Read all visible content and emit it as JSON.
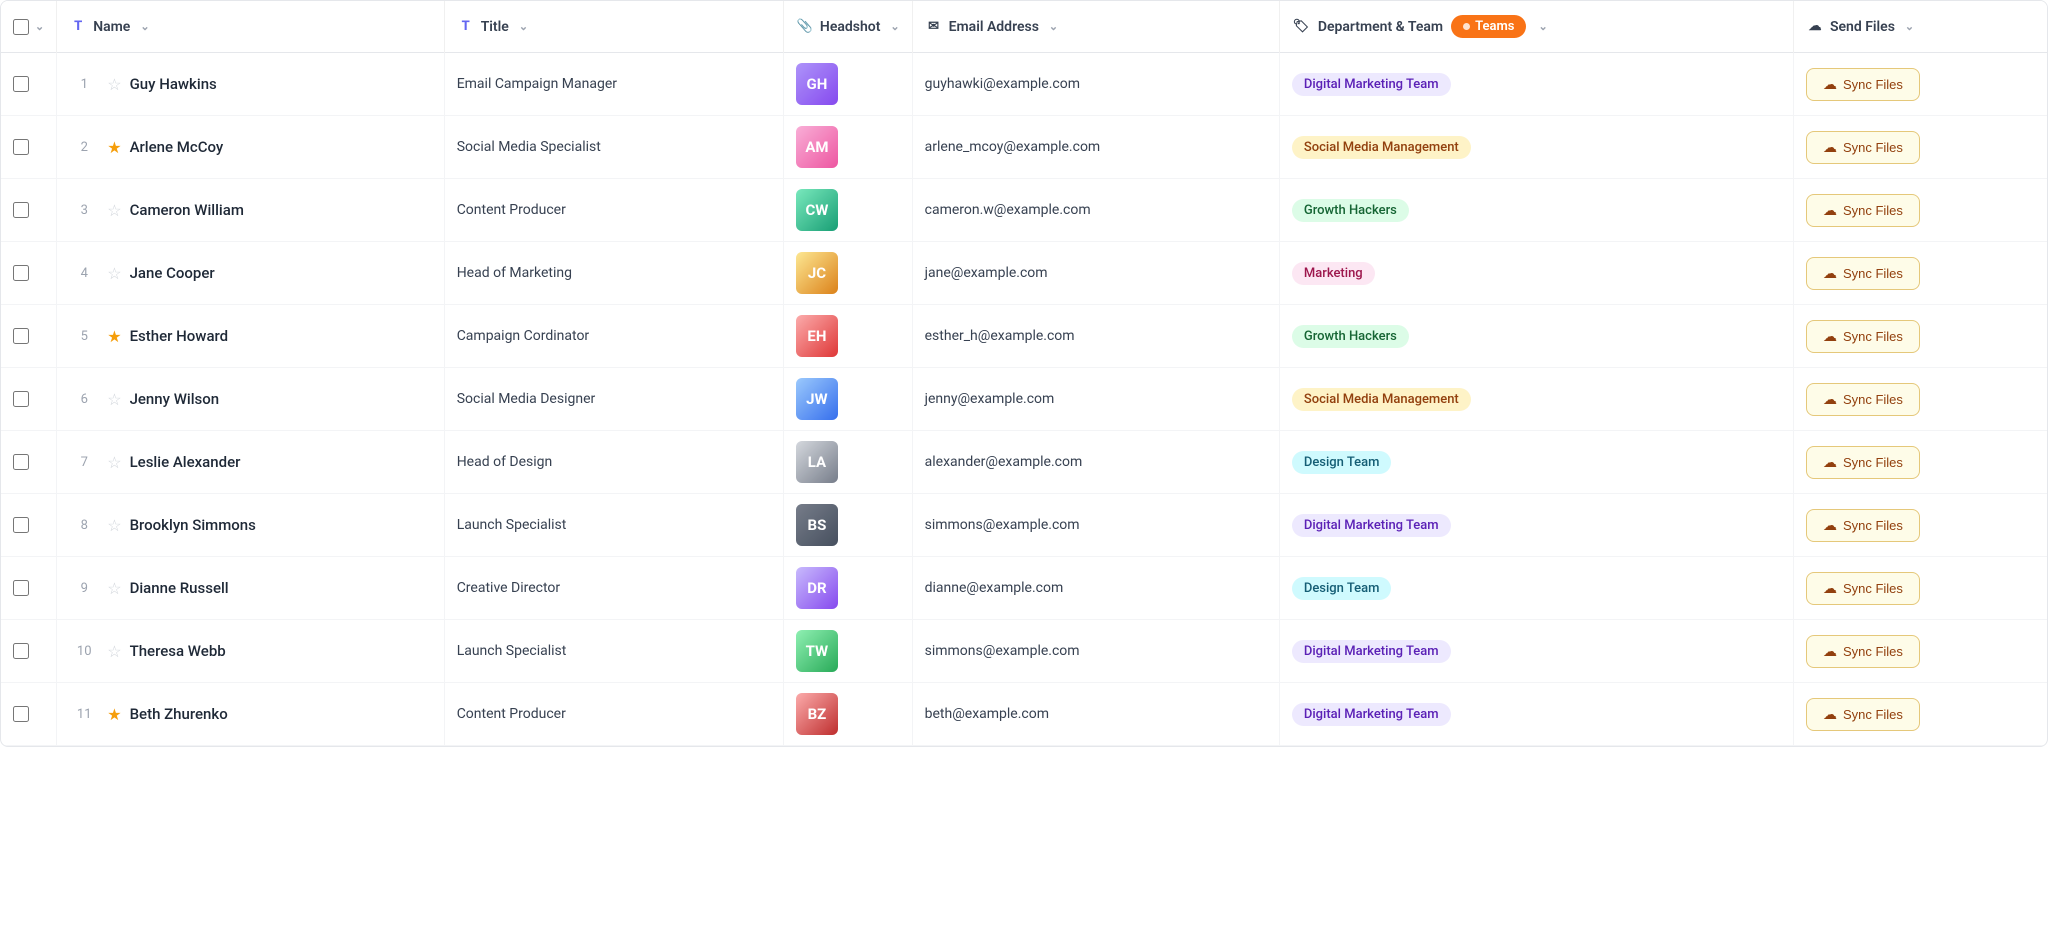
{
  "header": {
    "checkbox_label": "select-all",
    "columns": [
      {
        "id": "name",
        "icon": "T",
        "label": "Name",
        "sortable": true
      },
      {
        "id": "title",
        "icon": "T",
        "label": "Title",
        "sortable": true
      },
      {
        "id": "headshot",
        "icon": "📎",
        "label": "Headshot",
        "sortable": true
      },
      {
        "id": "email",
        "icon": "✉",
        "label": "Email Address",
        "sortable": true
      },
      {
        "id": "dept",
        "icon": "🏷",
        "label": "Department & Team",
        "sortable": true,
        "filter_badge": "Teams"
      },
      {
        "id": "send_files",
        "icon": "☁",
        "label": "Send Files",
        "sortable": true
      }
    ]
  },
  "rows": [
    {
      "num": 1,
      "starred": false,
      "name": "Guy Hawkins",
      "title": "Email Campaign Manager",
      "email": "guyhawki@example.com",
      "dept": "Digital Marketing Team",
      "dept_class": "badge-purple",
      "avatar_class": "av1",
      "avatar_initials": "GH",
      "sync_label": "Sync Files"
    },
    {
      "num": 2,
      "starred": true,
      "name": "Arlene McCoy",
      "title": "Social Media Specialist",
      "email": "arlene_mcoy@example.com",
      "dept": "Social Media Management",
      "dept_class": "badge-yellow",
      "avatar_class": "av2",
      "avatar_initials": "AM",
      "sync_label": "Sync Files"
    },
    {
      "num": 3,
      "starred": false,
      "name": "Cameron William",
      "title": "Content Producer",
      "email": "cameron.w@example.com",
      "dept": "Growth Hackers",
      "dept_class": "badge-green",
      "avatar_class": "av3",
      "avatar_initials": "CW",
      "sync_label": "Sync Files"
    },
    {
      "num": 4,
      "starred": false,
      "name": "Jane Cooper",
      "title": "Head of Marketing",
      "email": "jane@example.com",
      "dept": "Marketing",
      "dept_class": "badge-pink",
      "avatar_class": "av4",
      "avatar_initials": "JC",
      "sync_label": "Sync Files"
    },
    {
      "num": 5,
      "starred": true,
      "name": "Esther Howard",
      "title": "Campaign Cordinator",
      "email": "esther_h@example.com",
      "dept": "Growth Hackers",
      "dept_class": "badge-green",
      "avatar_class": "av5",
      "avatar_initials": "EH",
      "sync_label": "Sync Files"
    },
    {
      "num": 6,
      "starred": false,
      "name": "Jenny Wilson",
      "title": "Social Media Designer",
      "email": "jenny@example.com",
      "dept": "Social Media Management",
      "dept_class": "badge-yellow",
      "avatar_class": "av6",
      "avatar_initials": "JW",
      "sync_label": "Sync Files"
    },
    {
      "num": 7,
      "starred": false,
      "name": "Leslie Alexander",
      "title": "Head of Design",
      "email": "alexander@example.com",
      "dept": "Design Team",
      "dept_class": "badge-cyan",
      "avatar_class": "av7",
      "avatar_initials": "LA",
      "sync_label": "Sync Files"
    },
    {
      "num": 8,
      "starred": false,
      "name": "Brooklyn Simmons",
      "title": "Launch Specialist",
      "email": "simmons@example.com",
      "dept": "Digital Marketing Team",
      "dept_class": "badge-purple",
      "avatar_class": "av8",
      "avatar_initials": "BS",
      "sync_label": "Sync Files"
    },
    {
      "num": 9,
      "starred": false,
      "name": "Dianne Russell",
      "title": "Creative Director",
      "email": "dianne@example.com",
      "dept": "Design Team",
      "dept_class": "badge-cyan",
      "avatar_class": "av9",
      "avatar_initials": "DR",
      "sync_label": "Sync Files"
    },
    {
      "num": 10,
      "starred": false,
      "name": "Theresa Webb",
      "title": "Launch Specialist",
      "email": "simmons@example.com",
      "dept": "Digital Marketing Team",
      "dept_class": "badge-purple",
      "avatar_class": "av10",
      "avatar_initials": "TW",
      "sync_label": "Sync Files"
    },
    {
      "num": 11,
      "starred": true,
      "name": "Beth Zhurenko",
      "title": "Content Producer",
      "email": "beth@example.com",
      "dept": "Digital Marketing Team",
      "dept_class": "badge-purple",
      "avatar_class": "av11",
      "avatar_initials": "BZ",
      "sync_label": "Sync Files"
    }
  ],
  "icons": {
    "sync": "☁",
    "star_filled": "★",
    "star_empty": "☆",
    "chevron": "⌄",
    "teams_label": "Teams",
    "link_icon": "🔗"
  }
}
